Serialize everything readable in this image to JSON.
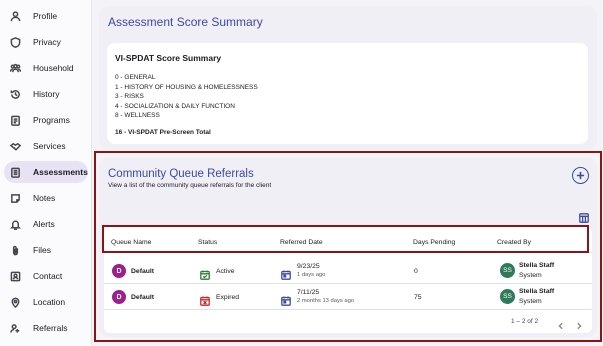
{
  "sidebar": {
    "items": [
      {
        "label": "Profile",
        "icon": "person-icon"
      },
      {
        "label": "Privacy",
        "icon": "shield-icon"
      },
      {
        "label": "Household",
        "icon": "group-icon"
      },
      {
        "label": "History",
        "icon": "history-icon"
      },
      {
        "label": "Programs",
        "icon": "clipboard-icon"
      },
      {
        "label": "Services",
        "icon": "handshake-icon"
      },
      {
        "label": "Assessments",
        "icon": "assessment-icon",
        "active": true
      },
      {
        "label": "Notes",
        "icon": "note-icon"
      },
      {
        "label": "Alerts",
        "icon": "bell-icon"
      },
      {
        "label": "Files",
        "icon": "paperclip-icon"
      },
      {
        "label": "Contact",
        "icon": "contact-icon"
      },
      {
        "label": "Location",
        "icon": "location-icon"
      },
      {
        "label": "Referrals",
        "icon": "referral-icon"
      }
    ]
  },
  "score_summary": {
    "title": "Assessment Score Summary",
    "heading": "VI-SPDAT Score Summary",
    "lines": [
      "0 - GENERAL",
      "1 - HISTORY OF HOUSING & HOMELESSNESS",
      "3 - RISKS",
      "4 - SOCIALIZATION & DAILY FUNCTION",
      "8 - WELLNESS"
    ],
    "total": "16 - VI-SPDAT Pre-Screen Total"
  },
  "referrals": {
    "title": "Community Queue Referrals",
    "subtitle": "View a list of the community queue referrals for the client",
    "columns": [
      "Queue Name",
      "Status",
      "Referred Date",
      "Days Pending",
      "Created By"
    ],
    "rows": [
      {
        "avatar": "D",
        "queue": "Default",
        "status": "Active",
        "status_color": "#2e7d32",
        "date": "9/23/25",
        "ago": "1 days ago",
        "days": "0",
        "creator_avatar": "SS",
        "creator": "Stella Staff",
        "creator_role": "System"
      },
      {
        "avatar": "D",
        "queue": "Default",
        "status": "Expired",
        "status_color": "#c62828",
        "date": "7/11/25",
        "ago": "2 months 13 days ago",
        "days": "75",
        "creator_avatar": "SS",
        "creator": "Stella Staff",
        "creator_role": "System"
      }
    ],
    "pagination": "1 – 2 of 2"
  },
  "colors": {
    "accent": "#3b4aa0",
    "highlight_outline": "#8b1414"
  }
}
